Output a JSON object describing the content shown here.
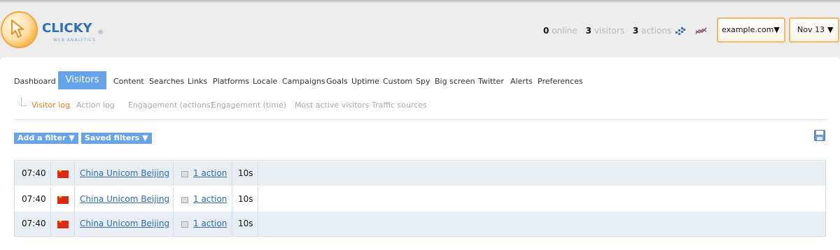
{
  "brand": {
    "name": "CLICKY",
    "registered": "®",
    "tagline": "WEB ANALYTICS"
  },
  "stats": {
    "online_count": "0",
    "online_label": "online",
    "visitors_count": "3",
    "visitors_label": "visitors",
    "actions_count": "3",
    "actions_label": "actions"
  },
  "site_selector": {
    "value": "example.com",
    "arrow": "▼"
  },
  "date_selector": {
    "value": "Nov 13",
    "arrow": "▼"
  },
  "nav": {
    "items": [
      "Dashboard",
      "Visitors",
      "Content",
      "Searches",
      "Links",
      "Platforms",
      "Locale",
      "Campaigns",
      "Goals",
      "Uptime",
      "Custom",
      "Spy",
      "Big screen",
      "Twitter",
      "Alerts",
      "Preferences"
    ],
    "active": "Visitors"
  },
  "subnav": {
    "items": [
      "Visitor log",
      "Action log",
      "Engagement (actions)",
      "Engagement (time)",
      "Most active visitors",
      "Traffic sources"
    ],
    "active": "Visitor log"
  },
  "filters": {
    "add_filter": "Add a filter ▼",
    "saved_filters": "Saved filters ▼"
  },
  "visitor_log": [
    {
      "time": "07:40",
      "flag": "china-flag-icon",
      "visitor": "China Unicom Beijing",
      "actions": "1 action",
      "duration": "10s"
    },
    {
      "time": "07:40",
      "flag": "china-flag-icon",
      "visitor": "China Unicom Beijing",
      "actions": "1 action",
      "duration": "10s"
    },
    {
      "time": "07:40",
      "flag": "china-flag-icon",
      "visitor": "China Unicom Beijing",
      "actions": "1 action",
      "duration": "10s"
    }
  ],
  "colors": {
    "accent_blue": "#66a3e9",
    "subnav_active": "#e27d23",
    "dropdown_border": "#f4b866",
    "row_alt": "#e9eef5"
  }
}
